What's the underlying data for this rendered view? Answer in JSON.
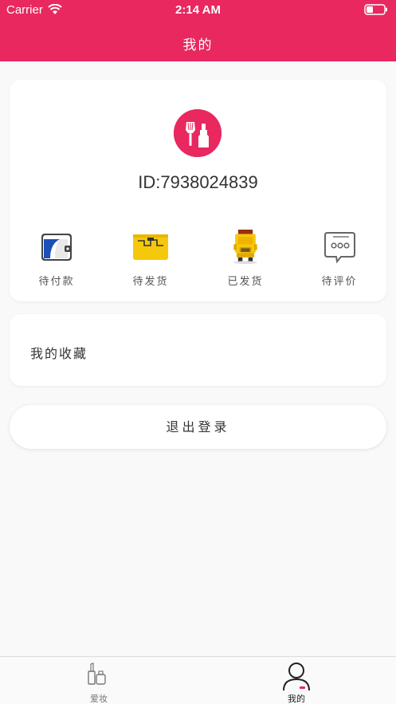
{
  "status_bar": {
    "carrier": "Carrier",
    "time": "2:14 AM"
  },
  "header": {
    "title": "我的"
  },
  "profile": {
    "id_text": "ID:7938024839",
    "avatar_icon": "makeup-brush-icon"
  },
  "orders": [
    {
      "label": "待付款",
      "icon": "wallet-icon"
    },
    {
      "label": "待发货",
      "icon": "package-icon"
    },
    {
      "label": "已发货",
      "icon": "truck-icon"
    },
    {
      "label": "待评价",
      "icon": "comment-icon"
    }
  ],
  "favorites": {
    "label": "我的收藏"
  },
  "logout": {
    "label": "退出登录"
  },
  "tabs": [
    {
      "label": "爱妆",
      "icon": "cosmetics-icon",
      "active": false
    },
    {
      "label": "我的",
      "icon": "user-icon",
      "active": true
    }
  ],
  "colors": {
    "accent": "#e8285f",
    "background": "#f9f9f9"
  }
}
